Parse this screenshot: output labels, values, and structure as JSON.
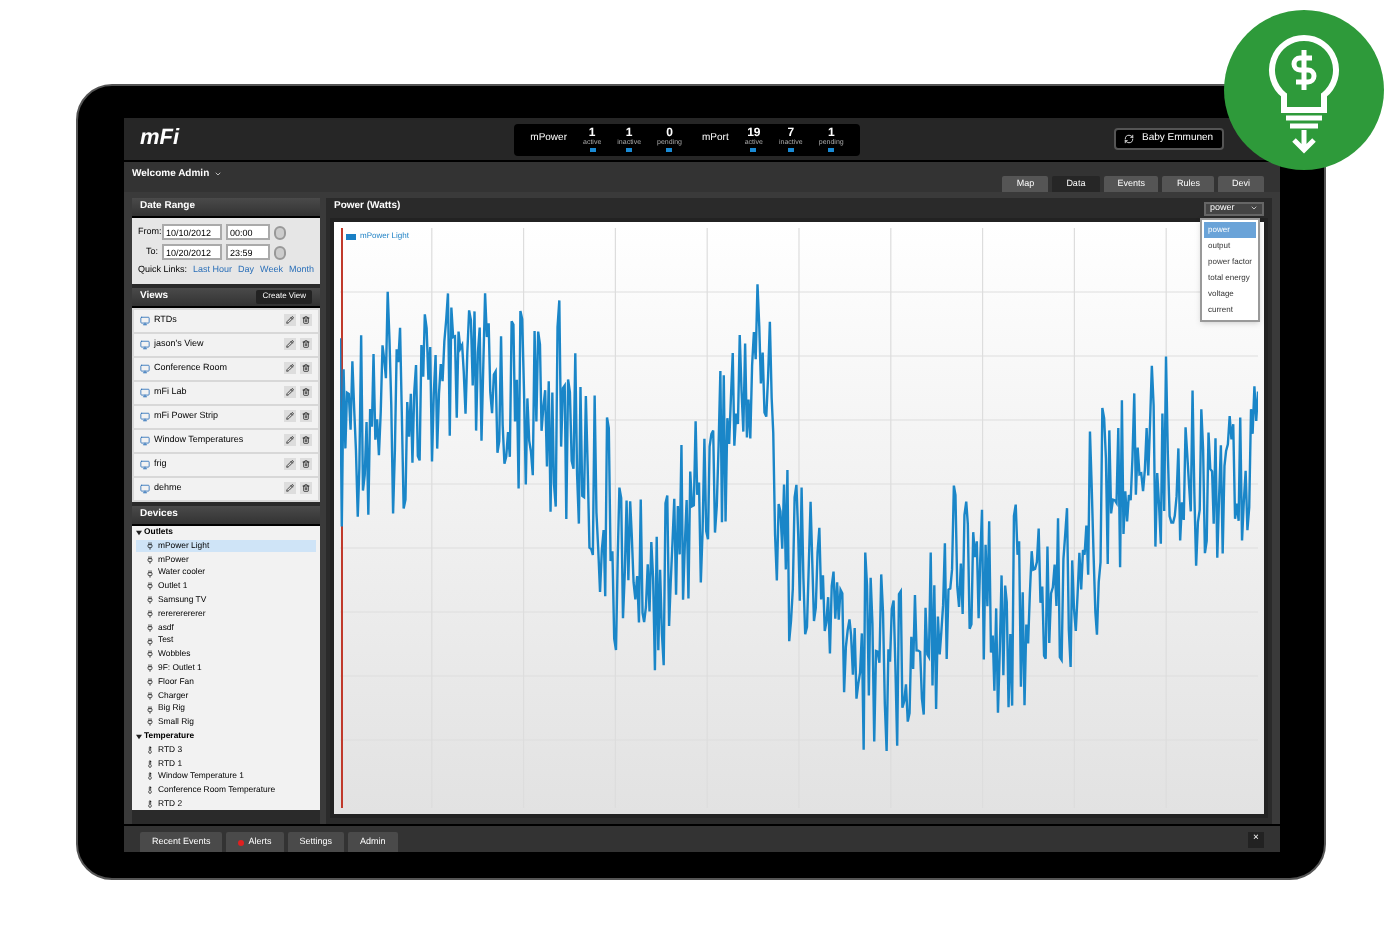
{
  "header": {
    "logo": "mFi",
    "stat_groups": [
      {
        "name": "mPower",
        "stats": [
          {
            "value": "1",
            "label": "active"
          },
          {
            "value": "1",
            "label": "inactive"
          },
          {
            "value": "0",
            "label": "pending"
          }
        ]
      },
      {
        "name": "mPort",
        "stats": [
          {
            "value": "19",
            "label": "active"
          },
          {
            "value": "7",
            "label": "inactive"
          },
          {
            "value": "1",
            "label": "pending"
          }
        ]
      }
    ],
    "site_button": "Baby Emmunen"
  },
  "welcome": "Welcome Admin",
  "tabs": [
    {
      "label": "Map",
      "selected": false
    },
    {
      "label": "Data",
      "selected": true
    },
    {
      "label": "Events",
      "selected": false
    },
    {
      "label": "Rules",
      "selected": false
    },
    {
      "label": "Devi",
      "selected": false
    }
  ],
  "date_range": {
    "title": "Date Range",
    "from_label": "From:",
    "from_date": "10/10/2012",
    "from_time": "00:00",
    "to_label": "To:",
    "to_date": "10/20/2012",
    "to_time": "23:59",
    "quick_links_label": "Quick Links:",
    "quick_links": [
      "Last Hour",
      "Day",
      "Week",
      "Month"
    ]
  },
  "views": {
    "title": "Views",
    "create_button": "Create View",
    "items": [
      "RTDs",
      "jason's View",
      "Conference Room",
      "mFi Lab",
      "mFi Power Strip",
      "Window Temperatures",
      "frig",
      "dehme"
    ]
  },
  "devices": {
    "title": "Devices",
    "groups": [
      {
        "label": "Outlets",
        "kind": "outlet",
        "expanded": true,
        "children": [
          {
            "label": "mPower Light",
            "selected": true
          },
          {
            "label": "mPower",
            "selected": false
          },
          {
            "label": "Water cooler",
            "selected": false
          },
          {
            "label": "Outlet 1",
            "selected": false
          },
          {
            "label": "Samsung TV",
            "selected": false
          },
          {
            "label": "rerererererer",
            "selected": false
          },
          {
            "label": "asdf",
            "selected": false
          },
          {
            "label": "Test",
            "selected": false
          },
          {
            "label": "Wobbles",
            "selected": false
          },
          {
            "label": "9F: Outlet 1",
            "selected": false
          },
          {
            "label": "Floor Fan",
            "selected": false
          },
          {
            "label": "Charger",
            "selected": false
          },
          {
            "label": "Big Rig",
            "selected": false
          },
          {
            "label": "Small Rig",
            "selected": false
          }
        ]
      },
      {
        "label": "Temperature",
        "kind": "temperature",
        "expanded": true,
        "children": [
          {
            "label": "RTD 3",
            "selected": false
          },
          {
            "label": "RTD 1",
            "selected": false
          },
          {
            "label": "Window Temperature 1",
            "selected": false
          },
          {
            "label": "Conference Room Temperature",
            "selected": false
          },
          {
            "label": "RTD 2",
            "selected": false
          }
        ]
      }
    ]
  },
  "chart": {
    "title": "Power (Watts)",
    "legend": "mPower Light",
    "metric_select": "power",
    "menu": [
      {
        "label": "power",
        "selected": true
      },
      {
        "label": "output",
        "selected": false
      },
      {
        "label": "power factor",
        "selected": false
      },
      {
        "label": "total energy",
        "selected": false
      },
      {
        "label": "voltage",
        "selected": false
      },
      {
        "label": "current",
        "selected": false
      }
    ]
  },
  "bottom_tabs": [
    {
      "label": "Recent Events",
      "alert": false
    },
    {
      "label": "Alerts",
      "alert": true
    },
    {
      "label": "Settings",
      "alert": false
    },
    {
      "label": "Admin",
      "alert": false
    }
  ],
  "bottom_close": "×"
}
